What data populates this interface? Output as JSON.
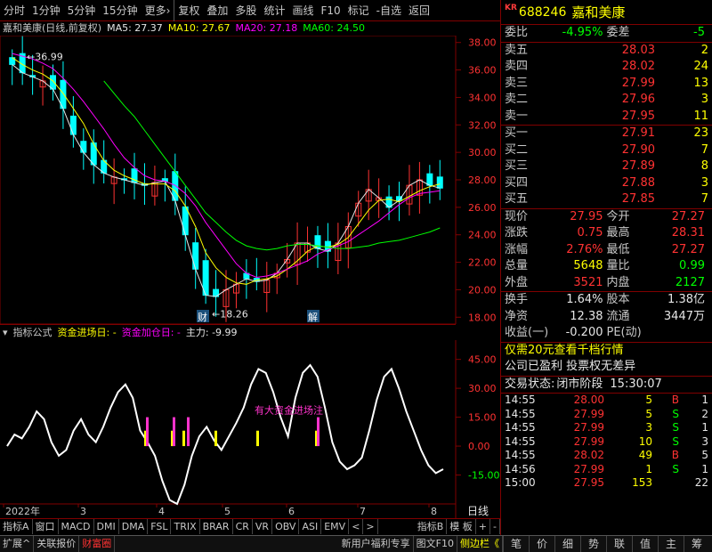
{
  "toolbar": {
    "items": [
      "分时",
      "1分钟",
      "5分钟",
      "15分钟",
      "更多›",
      "复权",
      "叠加",
      "多股",
      "统计",
      "画线",
      "F10",
      "标记",
      "-自选",
      "返回"
    ]
  },
  "stock": {
    "market_tag": "KR",
    "code": "688246",
    "name": "嘉和美康"
  },
  "chart_header": {
    "title": "嘉和美康(日线,前复权)",
    "ma5": "MA5: 27.37",
    "ma10": "MA10: 27.67",
    "ma20": "MA20: 27.18",
    "ma60": "MA60: 24.50"
  },
  "indicator_header": {
    "name": "指标公式",
    "l1": "资金进场日: -",
    "l2": "资金加仓日: -",
    "l3": "主力: -9.99"
  },
  "colors": {
    "up": "#ff3232",
    "down": "#00ffff",
    "ma5": "#e6e6e6",
    "ma10": "#ffff00",
    "ma20": "#ff00ff",
    "ma60": "#00ff00"
  },
  "chart_data": [
    {
      "type": "candlestick",
      "title": "嘉和美康(日线,前复权)",
      "ylim": [
        17.5,
        38.5
      ],
      "y_ticks": [
        "38.00",
        "36.00",
        "34.00",
        "32.00",
        "30.00",
        "28.00",
        "26.00",
        "24.00",
        "22.00",
        "20.00",
        "18.00"
      ],
      "x_ticks": [
        "2022年",
        "3",
        "4",
        "5",
        "6",
        "7",
        "8"
      ],
      "annotations": [
        "←36.99",
        "←18.26",
        "财",
        "解"
      ],
      "series": [
        {
          "name": "MA5",
          "values": [
            36.4,
            35.8,
            35.5,
            35.2,
            34.6,
            33.2,
            31.3,
            30.0,
            29.1,
            28.5,
            28.2,
            28.0,
            27.8,
            27.6,
            27.8,
            27.9,
            26.5,
            24.0,
            21.5,
            19.6,
            19.5,
            20.0,
            20.4,
            20.8,
            20.6,
            20.7,
            21.2,
            22.2,
            23.4,
            23.4,
            23.0,
            22.8,
            23.4,
            24.6,
            26.3,
            27.3,
            26.7,
            26.0,
            26.5,
            27.6,
            28.0,
            27.6,
            27.4
          ]
        },
        {
          "name": "MA10",
          "values": [
            36.9,
            36.4,
            36.0,
            35.7,
            35.2,
            34.3,
            33.2,
            32.1,
            30.6,
            29.4,
            28.7,
            28.3,
            28.0,
            27.7,
            27.7,
            27.7,
            27.2,
            26.1,
            24.6,
            22.7,
            21.6,
            20.9,
            20.5,
            20.4,
            20.7,
            20.8,
            21.0,
            21.5,
            22.1,
            22.8,
            23.2,
            23.1,
            23.3,
            23.8,
            24.8,
            25.8,
            26.5,
            26.6,
            26.4,
            26.8,
            27.2,
            27.5,
            27.7
          ]
        },
        {
          "name": "MA20",
          "values": [
            37.2,
            37.0,
            36.8,
            36.5,
            36.1,
            35.4,
            34.6,
            33.7,
            32.7,
            31.7,
            30.6,
            29.6,
            28.9,
            28.3,
            28.0,
            27.9,
            27.6,
            27.0,
            26.1,
            24.9,
            23.9,
            22.9,
            21.9,
            21.2,
            20.9,
            21.0,
            21.2,
            21.5,
            21.8,
            22.1,
            22.6,
            22.9,
            23.2,
            23.5,
            24.0,
            24.5,
            25.0,
            25.6,
            26.2,
            26.7,
            27.0,
            27.1,
            27.2
          ]
        },
        {
          "name": "MA60",
          "values": [
            null,
            null,
            null,
            null,
            null,
            null,
            null,
            null,
            null,
            35.2,
            34.3,
            33.4,
            32.6,
            31.6,
            30.6,
            29.6,
            28.6,
            27.6,
            26.6,
            25.6,
            24.9,
            24.2,
            23.6,
            23.2,
            23.0,
            22.9,
            23.0,
            23.2,
            23.3,
            23.3,
            23.2,
            23.1,
            23.0,
            23.0,
            23.1,
            23.2,
            23.4,
            23.5,
            23.6,
            23.8,
            24.0,
            24.2,
            24.5
          ]
        }
      ]
    },
    {
      "type": "line",
      "ylim": [
        -30,
        55
      ],
      "y_ticks": [
        "45.00",
        "30.00",
        "15.00",
        "0.00",
        "-15.00"
      ],
      "annotations": [
        "有大资金进场注"
      ],
      "series": [
        {
          "name": "主力",
          "values": [
            0,
            6,
            4,
            10,
            18,
            14,
            2,
            -5,
            -2,
            8,
            14,
            6,
            2,
            10,
            20,
            28,
            32,
            25,
            8,
            2,
            -5,
            -18,
            -28,
            -30,
            -20,
            -5,
            5,
            10,
            3,
            -2,
            5,
            12,
            20,
            32,
            40,
            38,
            28,
            15,
            5,
            25,
            38,
            42,
            36,
            20,
            2,
            -8,
            -12,
            -10,
            -6,
            8,
            24,
            36,
            40,
            30,
            18,
            8,
            -2,
            -10,
            -14,
            -12
          ]
        }
      ]
    }
  ],
  "order_book": {
    "wb_label": "委比",
    "wb_val": "-4.95%",
    "wc_label": "委差",
    "wc_val": "-5",
    "sells": [
      {
        "label": "卖五",
        "price": "28.03",
        "vol": "2"
      },
      {
        "label": "卖四",
        "price": "28.02",
        "vol": "24"
      },
      {
        "label": "卖三",
        "price": "27.99",
        "vol": "13"
      },
      {
        "label": "卖二",
        "price": "27.96",
        "vol": "3"
      },
      {
        "label": "卖一",
        "price": "27.95",
        "vol": "11"
      }
    ],
    "buys": [
      {
        "label": "买一",
        "price": "27.91",
        "vol": "23"
      },
      {
        "label": "买二",
        "price": "27.90",
        "vol": "7"
      },
      {
        "label": "买三",
        "price": "27.89",
        "vol": "8"
      },
      {
        "label": "买四",
        "price": "27.88",
        "vol": "3"
      },
      {
        "label": "买五",
        "price": "27.85",
        "vol": "7"
      }
    ]
  },
  "quote": [
    [
      {
        "l": "现价",
        "v": "27.95",
        "c": "red"
      },
      {
        "l": "今开",
        "v": "27.27",
        "c": "red"
      }
    ],
    [
      {
        "l": "涨跌",
        "v": "0.75",
        "c": "red"
      },
      {
        "l": "最高",
        "v": "28.31",
        "c": "red"
      }
    ],
    [
      {
        "l": "涨幅",
        "v": "2.76%",
        "c": "red"
      },
      {
        "l": "最低",
        "v": "27.27",
        "c": "red"
      }
    ],
    [
      {
        "l": "总量",
        "v": "5648",
        "c": "yellow"
      },
      {
        "l": "量比",
        "v": "0.99",
        "c": "green"
      }
    ],
    [
      {
        "l": "外盘",
        "v": "3521",
        "c": "red"
      },
      {
        "l": "内盘",
        "v": "2127",
        "c": "green"
      }
    ]
  ],
  "fund": [
    [
      {
        "l": "换手",
        "v": "1.64%"
      },
      {
        "l": "股本",
        "v": "1.38亿"
      }
    ],
    [
      {
        "l": "净资",
        "v": "12.38"
      },
      {
        "l": "流通",
        "v": "3447万"
      }
    ],
    [
      {
        "l": "收益(一)",
        "v": "-0.200"
      },
      {
        "l": "PE(动)",
        "v": ""
      }
    ]
  ],
  "promo": {
    "line1": "仅需20元查看千档行情",
    "line2": "公司已盈利 投票权无差异"
  },
  "trade_status": {
    "label": "交易状态:",
    "value": "闭市阶段",
    "time": "15:30:07"
  },
  "trades": [
    {
      "t": "14:55",
      "p": "28.00",
      "q": "5",
      "bs": "B",
      "n": "1"
    },
    {
      "t": "14:55",
      "p": "27.99",
      "q": "5",
      "bs": "S",
      "n": "2"
    },
    {
      "t": "14:55",
      "p": "27.99",
      "q": "3",
      "bs": "S",
      "n": "1"
    },
    {
      "t": "14:55",
      "p": "27.99",
      "q": "10",
      "bs": "S",
      "n": "3"
    },
    {
      "t": "14:55",
      "p": "28.02",
      "q": "49",
      "bs": "B",
      "n": "5"
    },
    {
      "t": "14:56",
      "p": "27.99",
      "q": "1",
      "bs": "S",
      "n": "1"
    },
    {
      "t": "15:00",
      "p": "27.95",
      "q": "153",
      "bs": "",
      "n": "22"
    }
  ],
  "bottom_tabs": [
    "指标A",
    "窗口",
    "MACD",
    "DMI",
    "DMA",
    "FSL",
    "TRIX",
    "BRAR",
    "CR",
    "VR",
    "OBV",
    "ASI",
    "EMV",
    "<",
    ">",
    "指标B",
    "模 板",
    "+",
    "-"
  ],
  "right_bottom": {
    "label": "日线"
  },
  "status_bar": {
    "items": [
      "扩展^",
      "关联报价",
      "财富圈"
    ],
    "right_items": [
      "新用户福利专享",
      "图文F10",
      "侧边栏《"
    ]
  },
  "side_tabs": [
    "笔",
    "价",
    "细",
    "势",
    "联",
    "值",
    "主",
    "筹"
  ]
}
